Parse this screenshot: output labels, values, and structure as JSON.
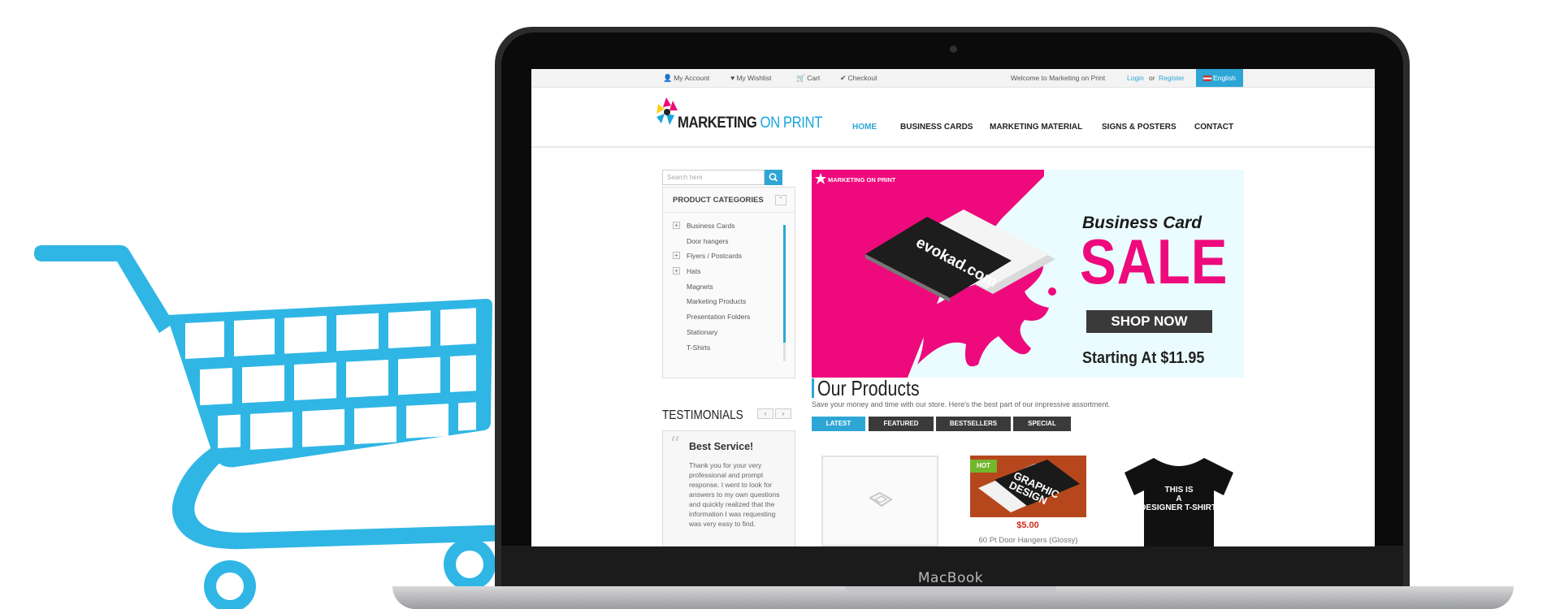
{
  "device_label": "MacBook",
  "topbar": {
    "my_account": "My Account",
    "my_wishlist": "My Wishlist",
    "cart": "Cart",
    "checkout": "Checkout",
    "welcome": "Welcome to Marketing on Print",
    "login": "Login",
    "or": "or",
    "register": "Register",
    "language": "English"
  },
  "logo": {
    "part1": "MARKETING",
    "part2": "ON PRINT"
  },
  "nav": [
    "HOME",
    "BUSINESS CARDS",
    "MARKETING MATERIAL",
    "SIGNS & POSTERS",
    "CONTACT"
  ],
  "search": {
    "placeholder": "Search here"
  },
  "categories": {
    "title": "PRODUCT CATEGORIES",
    "items": [
      {
        "label": "Business Cards",
        "expandable": true
      },
      {
        "label": "Door hangers",
        "expandable": false
      },
      {
        "label": "Flyers / Postcards",
        "expandable": true
      },
      {
        "label": "Hats",
        "expandable": true
      },
      {
        "label": "Magnets",
        "expandable": false
      },
      {
        "label": "Marketing Products",
        "expandable": false
      },
      {
        "label": "Presentation Folders",
        "expandable": false
      },
      {
        "label": "Stationary",
        "expandable": false
      },
      {
        "label": "T-Shirts",
        "expandable": false
      }
    ]
  },
  "testimonials": {
    "title": "TESTIMONIALS",
    "heading": "Best Service!",
    "text": "Thank you for your very professional and prompt response. I went to look for answers to my own questions and quickly realized that the information I was requesting was very easy to find."
  },
  "banner": {
    "brand": "MARKETING ON PRINT",
    "card_text": "evokad.com",
    "title": "Business Card",
    "sale": "SALE",
    "cta": "SHOP NOW",
    "starting": "Starting At $11.95"
  },
  "products": {
    "title": "Our Products",
    "subtitle": "Save your money and time with our store. Here's the best part of our impressive assortment.",
    "tabs": [
      "LATEST",
      "FEATURED",
      "BESTSELLERS",
      "SPECIAL"
    ],
    "hot_badge": "HOT",
    "item2_image_text": "GRAPHIC DESIGN",
    "item2_price": "$5.00",
    "item2_name": "60 Pt Door Hangers (Glossy)",
    "item3_image_text": "THIS IS A DESIGNER T-SHIRT."
  },
  "colors": {
    "accent": "#2da6d6",
    "sale_pink": "#ee0a7c",
    "cart_blue": "#2fb6e5",
    "hot_green": "#72b72c"
  }
}
